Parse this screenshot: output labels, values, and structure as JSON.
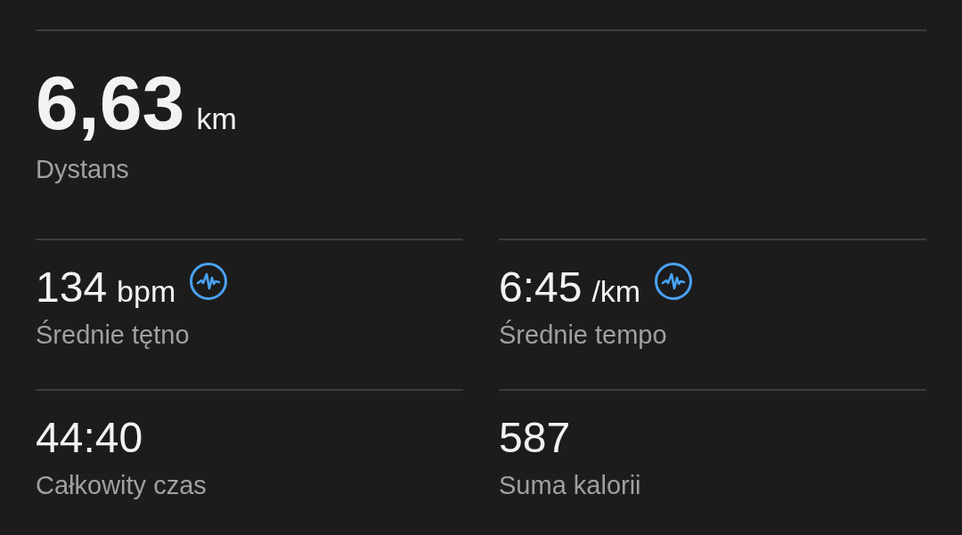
{
  "primary_stat": {
    "value": "6,63",
    "unit": "km",
    "label": "Dystans"
  },
  "stats": [
    {
      "value": "134",
      "unit": "bpm",
      "label": "Średnie tętno",
      "has_icon": true
    },
    {
      "value": "6:45",
      "unit": "/km",
      "label": "Średnie tempo",
      "has_icon": true
    },
    {
      "value": "44:40",
      "label": "Całkowity czas",
      "has_icon": false
    },
    {
      "value": "587",
      "label": "Suma kalorii",
      "has_icon": false
    }
  ]
}
